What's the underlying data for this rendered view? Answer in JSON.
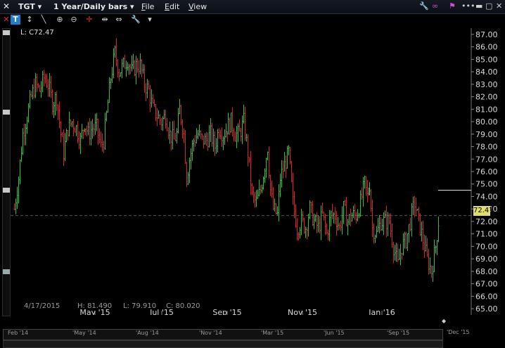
{
  "titlebar": {
    "symbol": "TGT",
    "period": "1 Year/Daily bars",
    "menus": [
      {
        "u": "F",
        "rest": "ile"
      },
      {
        "u": "E",
        "rest": "dit"
      },
      {
        "u": "V",
        "rest": "iew"
      }
    ]
  },
  "legend_text": "L: C72.47",
  "current_price": "72.47",
  "info_bar": {
    "date": "4/17/2015",
    "high": "H: 81.490",
    "low": "L: 79.910",
    "close": "C: 80.020"
  },
  "navigator_labels": [
    "Feb '14",
    "'May '14",
    "'Aug '14",
    "'Nov '14",
    "'Mar '15",
    "'Jun '15",
    "'Sep '15",
    "'Dec '15"
  ],
  "chart_data": {
    "type": "candlestick",
    "y_ticks": [
      "87.00",
      "86.00",
      "85.00",
      "84.00",
      "83.00",
      "82.00",
      "81.00",
      "80.00",
      "79.00",
      "78.00",
      "77.00",
      "76.00",
      "75.00",
      "74.00",
      "73.00",
      "72.00",
      "71.00",
      "70.00",
      "69.00",
      "68.00",
      "67.00",
      "66.00",
      "65.00"
    ],
    "x_ticks": [
      "May '15",
      "Jul '15",
      "Sep '15",
      "Nov '15",
      "Jan '16"
    ],
    "ylim": [
      64.5,
      87.5
    ],
    "close_path": [
      [
        0,
        73.0
      ],
      [
        6,
        75.5
      ],
      [
        12,
        79.0
      ],
      [
        18,
        80.5
      ],
      [
        24,
        82.0
      ],
      [
        30,
        83.0
      ],
      [
        36,
        82.5
      ],
      [
        42,
        83.5
      ],
      [
        48,
        83.0
      ],
      [
        54,
        81.5
      ],
      [
        60,
        82.0
      ],
      [
        66,
        79.0
      ],
      [
        70,
        77.5
      ],
      [
        76,
        79.5
      ],
      [
        82,
        80.0
      ],
      [
        88,
        79.5
      ],
      [
        94,
        78.5
      ],
      [
        100,
        80.0
      ],
      [
        106,
        79.0
      ],
      [
        112,
        79.5
      ],
      [
        118,
        79.5
      ],
      [
        124,
        78.0
      ],
      [
        128,
        78.5
      ],
      [
        132,
        80.5
      ],
      [
        138,
        83.5
      ],
      [
        144,
        85.5
      ],
      [
        150,
        84.0
      ],
      [
        156,
        84.5
      ],
      [
        162,
        85.0
      ],
      [
        168,
        84.0
      ],
      [
        174,
        84.5
      ],
      [
        180,
        84.5
      ],
      [
        186,
        83.0
      ],
      [
        192,
        82.5
      ],
      [
        198,
        81.0
      ],
      [
        204,
        80.5
      ],
      [
        210,
        80.0
      ],
      [
        216,
        80.5
      ],
      [
        222,
        79.0
      ],
      [
        228,
        78.5
      ],
      [
        232,
        79.0
      ],
      [
        236,
        81.0
      ],
      [
        242,
        79.0
      ],
      [
        246,
        75.5
      ],
      [
        250,
        77.0
      ],
      [
        256,
        78.5
      ],
      [
        262,
        79.0
      ],
      [
        268,
        78.5
      ],
      [
        274,
        78.5
      ],
      [
        280,
        79.0
      ],
      [
        286,
        78.0
      ],
      [
        292,
        79.5
      ],
      [
        298,
        79.0
      ],
      [
        304,
        79.5
      ],
      [
        310,
        80.0
      ],
      [
        316,
        79.0
      ],
      [
        322,
        79.0
      ],
      [
        328,
        80.0
      ],
      [
        334,
        77.5
      ],
      [
        340,
        74.0
      ],
      [
        346,
        73.5
      ],
      [
        352,
        74.5
      ],
      [
        358,
        76.5
      ],
      [
        362,
        78.0
      ],
      [
        366,
        74.5
      ],
      [
        370,
        73.0
      ],
      [
        376,
        72.5
      ],
      [
        380,
        75.5
      ],
      [
        386,
        76.5
      ],
      [
        392,
        77.5
      ],
      [
        398,
        73.5
      ],
      [
        404,
        71.5
      ],
      [
        410,
        72.0
      ],
      [
        416,
        71.5
      ],
      [
        422,
        73.0
      ],
      [
        428,
        72.0
      ],
      [
        434,
        71.5
      ],
      [
        440,
        72.5
      ],
      [
        446,
        71.0
      ],
      [
        452,
        72.5
      ],
      [
        458,
        72.5
      ],
      [
        464,
        71.5
      ],
      [
        470,
        73.0
      ],
      [
        476,
        72.0
      ],
      [
        482,
        72.5
      ],
      [
        488,
        72.5
      ],
      [
        494,
        73.5
      ],
      [
        500,
        75.0
      ],
      [
        504,
        74.0
      ],
      [
        508,
        75.0
      ],
      [
        512,
        71.5
      ],
      [
        518,
        71.0
      ],
      [
        524,
        72.0
      ],
      [
        530,
        72.0
      ],
      [
        536,
        72.0
      ],
      [
        542,
        70.0
      ],
      [
        548,
        68.5
      ],
      [
        554,
        70.0
      ],
      [
        560,
        70.5
      ],
      [
        566,
        72.0
      ],
      [
        572,
        73.5
      ],
      [
        578,
        72.0
      ],
      [
        584,
        70.5
      ],
      [
        590,
        69.0
      ],
      [
        596,
        68.0
      ],
      [
        602,
        70.0
      ],
      [
        606,
        72.0
      ],
      [
        608,
        72.47
      ]
    ],
    "last_close": 72.47,
    "reference_line": 74.5
  }
}
